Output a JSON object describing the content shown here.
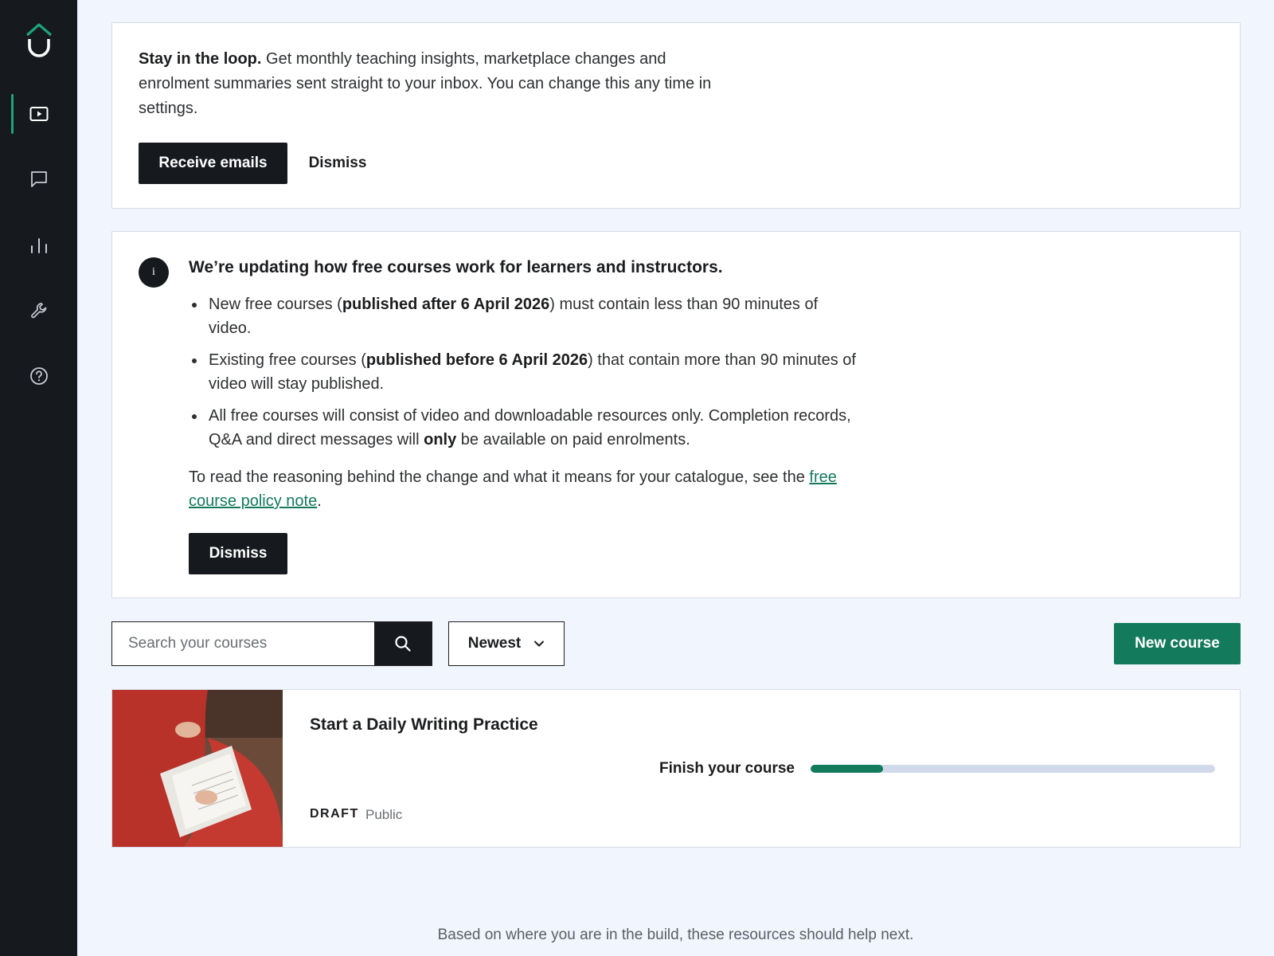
{
  "sidebar": {
    "logo": "app-logo",
    "items": [
      {
        "name": "courses",
        "icon": "play-video-icon",
        "active": true
      },
      {
        "name": "communication",
        "icon": "chat-bubble-icon",
        "active": false
      },
      {
        "name": "performance",
        "icon": "bar-chart-icon",
        "active": false
      },
      {
        "name": "tools",
        "icon": "wrench-icon",
        "active": false
      },
      {
        "name": "help",
        "icon": "help-circle-icon",
        "active": false
      }
    ],
    "accent": "#1ea47a"
  },
  "email_banner": {
    "lead": "Stay in the loop.",
    "body": " Get monthly teaching insights, marketplace changes and enrolment summaries sent straight to your inbox. You can change this any time in settings.",
    "receive_label": "Receive emails",
    "dismiss_label": "Dismiss"
  },
  "policy_banner": {
    "info_icon": "i",
    "title": "We’re updating how free courses work for learners and instructors.",
    "bullets": [
      {
        "pre": "New free courses (",
        "bold": "published after 6 April 2026",
        "post": ") must contain less than 90 minutes of video."
      },
      {
        "pre": "Existing free courses (",
        "bold": "published before 6 April 2026",
        "post": ") that contain more than 90 minutes of video will stay published."
      },
      {
        "pre": "All free courses will consist of video and downloadable resources only. Completion records, Q&A and direct messages will ",
        "bold": "only",
        "post": " be available on paid enrolments."
      }
    ],
    "note_pre": "To read the reasoning behind the change and what it means for your catalogue, see the ",
    "note_link": "free course policy note",
    "note_post": ".",
    "dismiss_label": "Dismiss"
  },
  "toolbar": {
    "search_placeholder": "Search your courses",
    "search_icon": "search-icon",
    "sort_value": "Newest",
    "new_course_label": "New course"
  },
  "course": {
    "title": "Start a Daily Writing Practice",
    "progress_label": "Finish your course",
    "progress_fraction": 0.18,
    "status": "DRAFT",
    "visibility": "Public"
  },
  "footer": {
    "note": "Based on where you are in the build, these resources should help next."
  },
  "colors": {
    "primary_green": "#137a5b",
    "dark": "#16191e",
    "page_bg": "#f1f5fd"
  }
}
